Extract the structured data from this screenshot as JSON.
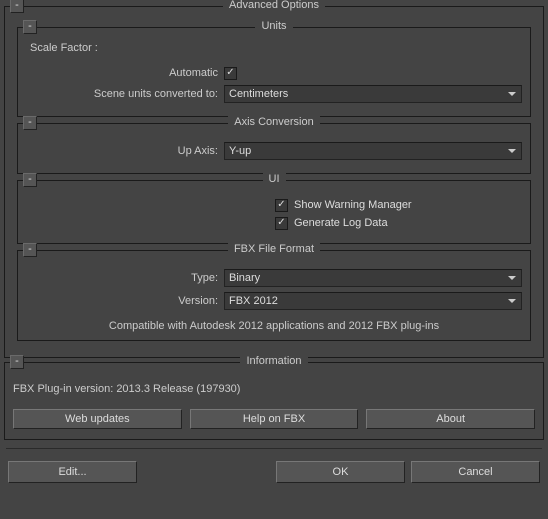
{
  "advanced": {
    "title": "Advanced Options",
    "units": {
      "title": "Units",
      "scale_factor_label": "Scale Factor :",
      "automatic_label": "Automatic",
      "automatic_checked": true,
      "converted_label": "Scene units converted to:",
      "converted_value": "Centimeters"
    },
    "axis": {
      "title": "Axis Conversion",
      "up_axis_label": "Up Axis:",
      "up_axis_value": "Y-up"
    },
    "ui": {
      "title": "UI",
      "show_warning_label": "Show Warning Manager",
      "show_warning_checked": true,
      "generate_log_label": "Generate Log Data",
      "generate_log_checked": true
    },
    "format": {
      "title": "FBX File Format",
      "type_label": "Type:",
      "type_value": "Binary",
      "version_label": "Version:",
      "version_value": "FBX 2012",
      "compat_text": "Compatible with Autodesk 2012 applications and 2012 FBX plug-ins"
    }
  },
  "info": {
    "title": "Information",
    "plugin_text": "FBX Plug-in version: 2013.3 Release (197930)",
    "web_updates": "Web updates",
    "help": "Help on FBX",
    "about": "About"
  },
  "footer": {
    "edit": "Edit...",
    "ok": "OK",
    "cancel": "Cancel"
  },
  "collapse_glyph": "-"
}
